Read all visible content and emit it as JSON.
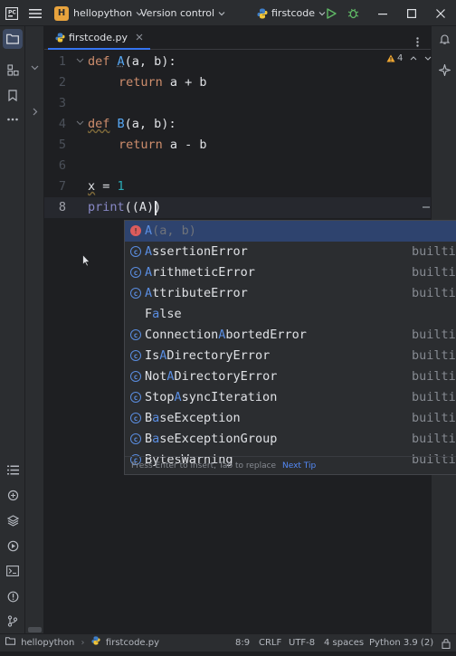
{
  "titlebar": {
    "project_badge": "H",
    "project_name": "hellopython",
    "vcs_label": "Version control",
    "run_config": "firstcode",
    "colors": {
      "badge": "#e8a33d",
      "run": "#5fb865",
      "debug": "#5fb865"
    }
  },
  "tab": {
    "filename": "firstcode.py"
  },
  "editor": {
    "inspection_count": "4",
    "lines": [
      {
        "num": "1"
      },
      {
        "num": "2"
      },
      {
        "num": "3"
      },
      {
        "num": "4"
      },
      {
        "num": "5"
      },
      {
        "num": "6"
      },
      {
        "num": "7"
      },
      {
        "num": "8"
      }
    ],
    "tokens": {
      "l1_def": "def",
      "l1_name": "A",
      "l1_rest": "(a, b):",
      "l2_ret": "return",
      "l2_expr": " a + b",
      "l4_def": "def",
      "l4_name": "B",
      "l4_rest": "(a, b):",
      "l5_ret": "return",
      "l5_expr": " a - b",
      "l7_var": "x",
      "l7_eq": " = ",
      "l7_val": "1",
      "l8_print": "print",
      "l8_rest": "((A))"
    }
  },
  "completion": {
    "items": [
      {
        "icon": "error",
        "pre": "",
        "hl": "A",
        "post": "(a, b)",
        "source": ""
      },
      {
        "icon": "class",
        "pre": "",
        "hl": "A",
        "post": "ssertionError",
        "source": "builtii"
      },
      {
        "icon": "class",
        "pre": "",
        "hl": "A",
        "post": "rithmeticError",
        "source": "builtii"
      },
      {
        "icon": "class",
        "pre": "",
        "hl": "A",
        "post": "ttributeError",
        "source": "builtii"
      },
      {
        "icon": "none",
        "pre": "F",
        "hl": "a",
        "post": "lse",
        "source": ""
      },
      {
        "icon": "class",
        "pre": "Connection",
        "hl": "A",
        "post": "bortedError",
        "source": "builtii"
      },
      {
        "icon": "class",
        "pre": "Is",
        "hl": "A",
        "post": "DirectoryError",
        "source": "builtii"
      },
      {
        "icon": "class",
        "pre": "Not",
        "hl": "A",
        "post": "DirectoryError",
        "source": "builtii"
      },
      {
        "icon": "class",
        "pre": "Stop",
        "hl": "A",
        "post": "syncIteration",
        "source": "builtii"
      },
      {
        "icon": "class",
        "pre": "B",
        "hl": "a",
        "post": "seException",
        "source": "builtii"
      },
      {
        "icon": "class",
        "pre": "B",
        "hl": "a",
        "post": "seExceptionGroup",
        "source": "builtii"
      },
      {
        "icon": "class",
        "pre": "BytesWarning",
        "hl": "",
        "post": "",
        "source": "builtii"
      }
    ],
    "footer_hint": "Press Enter to insert, Tab to replace",
    "footer_tip": "Next Tip"
  },
  "statusbar": {
    "project": "hellopython",
    "file": "firstcode.py",
    "position": "8:9",
    "line_sep": "CRLF",
    "encoding": "UTF-8",
    "indent": "4 spaces",
    "interpreter": "Python 3.9 (2)"
  }
}
